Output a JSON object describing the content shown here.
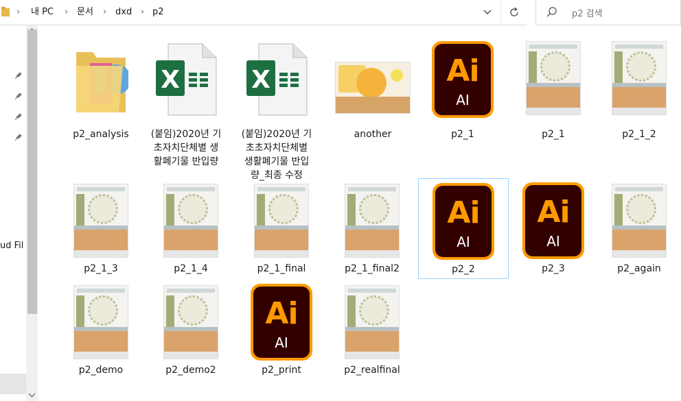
{
  "breadcrumb": [
    "내 PC",
    "문서",
    "dxd",
    "p2"
  ],
  "search": {
    "placeholder": "p2 검색"
  },
  "nav": {
    "partial_label": "ud Fil"
  },
  "files": [
    {
      "name": "p2_analysis",
      "type": "folder"
    },
    {
      "name": "(붙임)2020년 기초자치단체별 생활폐기물 반입량",
      "type": "excel"
    },
    {
      "name": "(붙임)2020년 기초초자치단체별 생활폐기물 반입량_최종 수정",
      "type": "excel"
    },
    {
      "name": "another",
      "type": "image"
    },
    {
      "name": "p2_1",
      "type": "ai"
    },
    {
      "name": "p2_1",
      "type": "image"
    },
    {
      "name": "p2_1_2",
      "type": "image"
    },
    {
      "name": "p2_1_3",
      "type": "image"
    },
    {
      "name": "p2_1_4",
      "type": "image"
    },
    {
      "name": "p2_1_final",
      "type": "image"
    },
    {
      "name": "p2_1_final2",
      "type": "image"
    },
    {
      "name": "p2_2",
      "type": "ai",
      "selected": true
    },
    {
      "name": "p2_3",
      "type": "ai"
    },
    {
      "name": "p2_again",
      "type": "image"
    },
    {
      "name": "p2_demo",
      "type": "image"
    },
    {
      "name": "p2_demo2",
      "type": "image"
    },
    {
      "name": "p2_print",
      "type": "ai"
    },
    {
      "name": "p2_realfinal",
      "type": "image"
    }
  ],
  "labels": {
    "excel1": [
      "(붙임)2020년 기",
      "초자치단체별 생",
      "활폐기물 반입량"
    ],
    "excel2": [
      "(붙임)2020년 기",
      "초초자치단체별",
      "생활폐기물 반입",
      "량_최종 수정"
    ]
  },
  "ai_icon": {
    "big": "Ai",
    "small": "AI"
  },
  "colors": {
    "ai_orange": "#ff9a00",
    "ai_dark": "#330000",
    "excel_green": "#1d6f42",
    "selection": "#99d1ff"
  }
}
